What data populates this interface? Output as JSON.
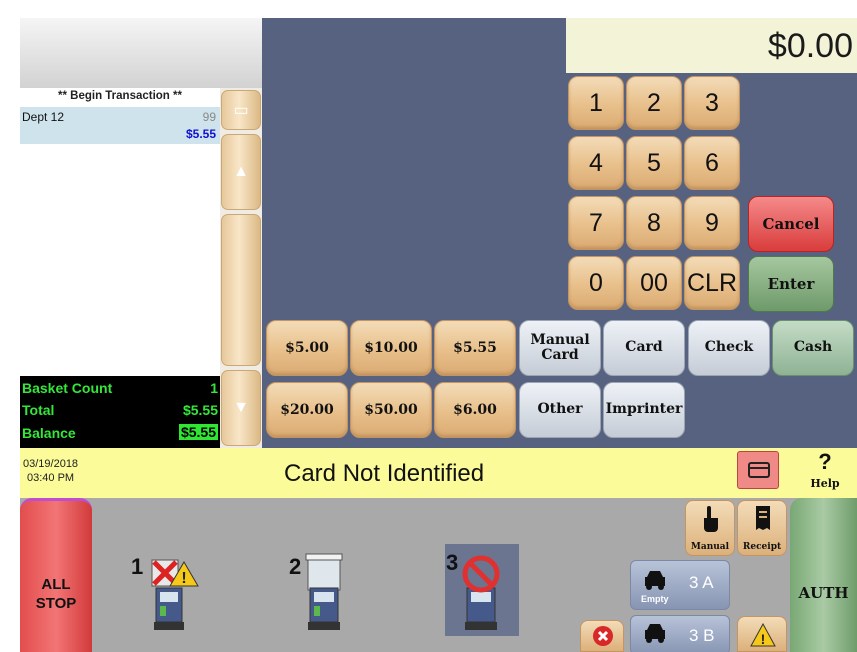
{
  "receipt": {
    "begin_label": "** Begin Transaction **",
    "items": [
      {
        "name": "Dept 12",
        "qty": "99",
        "price": "$5.55"
      }
    ]
  },
  "totals": {
    "basket_count_label": "Basket Count",
    "basket_count": "1",
    "total_label": "Total",
    "total": "$5.55",
    "balance_label": "Balance",
    "balance": "$5.55"
  },
  "display": {
    "amount": "$0.00"
  },
  "keypad": {
    "keys": [
      "1",
      "2",
      "3",
      "4",
      "5",
      "6",
      "7",
      "8",
      "9",
      "0",
      "00",
      "CLR"
    ],
    "cancel": "Cancel",
    "enter": "Enter"
  },
  "tender": {
    "row1": [
      "$5.00",
      "$10.00",
      "$5.55"
    ],
    "row2": [
      "$20.00",
      "$50.00",
      "$6.00"
    ],
    "manual_card": "Manual Card",
    "card": "Card",
    "check": "Check",
    "cash": "Cash",
    "other": "Other",
    "imprinter": "Imprinter"
  },
  "status": {
    "date": "03/19/2018",
    "time": "03:40 PM",
    "message": "Card Not Identified",
    "help_label": "Help",
    "help_glyph": "?"
  },
  "bottom": {
    "all_stop": "ALL STOP",
    "auth": "AUTH",
    "pumps": [
      {
        "number": "1",
        "state": "alert"
      },
      {
        "number": "2",
        "state": "idle"
      },
      {
        "number": "3",
        "state": "blocked"
      }
    ],
    "manual_label": "Manual",
    "receipt_label": "Receipt",
    "vehicle_3a": "3 A",
    "vehicle_3a_status": "Empty",
    "vehicle_3b": "3 B"
  },
  "colors": {
    "panel_blue": "#56627f",
    "status_yellow": "#fbfb9a",
    "totals_green": "#35e63a",
    "price_blue": "#1010d0"
  }
}
